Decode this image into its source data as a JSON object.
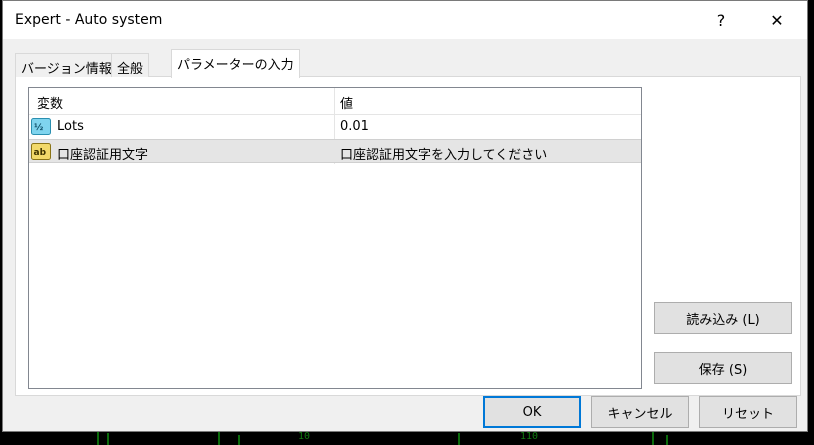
{
  "window": {
    "title": "Expert - Auto system",
    "help_glyph": "?",
    "close_glyph": "✕"
  },
  "tabs": [
    {
      "label": "バージョン情報"
    },
    {
      "label": "全般"
    },
    {
      "label": "パラメーターの入力",
      "active": true
    }
  ],
  "table": {
    "columns": [
      "変数",
      "値"
    ],
    "rows": [
      {
        "icon": "numeric-value-icon",
        "name": "Lots",
        "value": "0.01"
      },
      {
        "icon": "text-string-icon",
        "name": "口座認証用文字",
        "value": "口座認証用文字を入力してください",
        "selected": true
      }
    ]
  },
  "side_buttons": {
    "load_label": "読み込み (L)",
    "save_label": "保存 (S)"
  },
  "footer_buttons": {
    "ok_label": "OK",
    "cancel_label": "キャンセル",
    "reset_label": "リセット"
  },
  "background": {
    "fragment_1": "10",
    "fragment_2": "110"
  },
  "colors": {
    "dialog_bg": "#f0f0f0",
    "accent": "#0078d7",
    "selected_row": "#e5e5e5"
  }
}
